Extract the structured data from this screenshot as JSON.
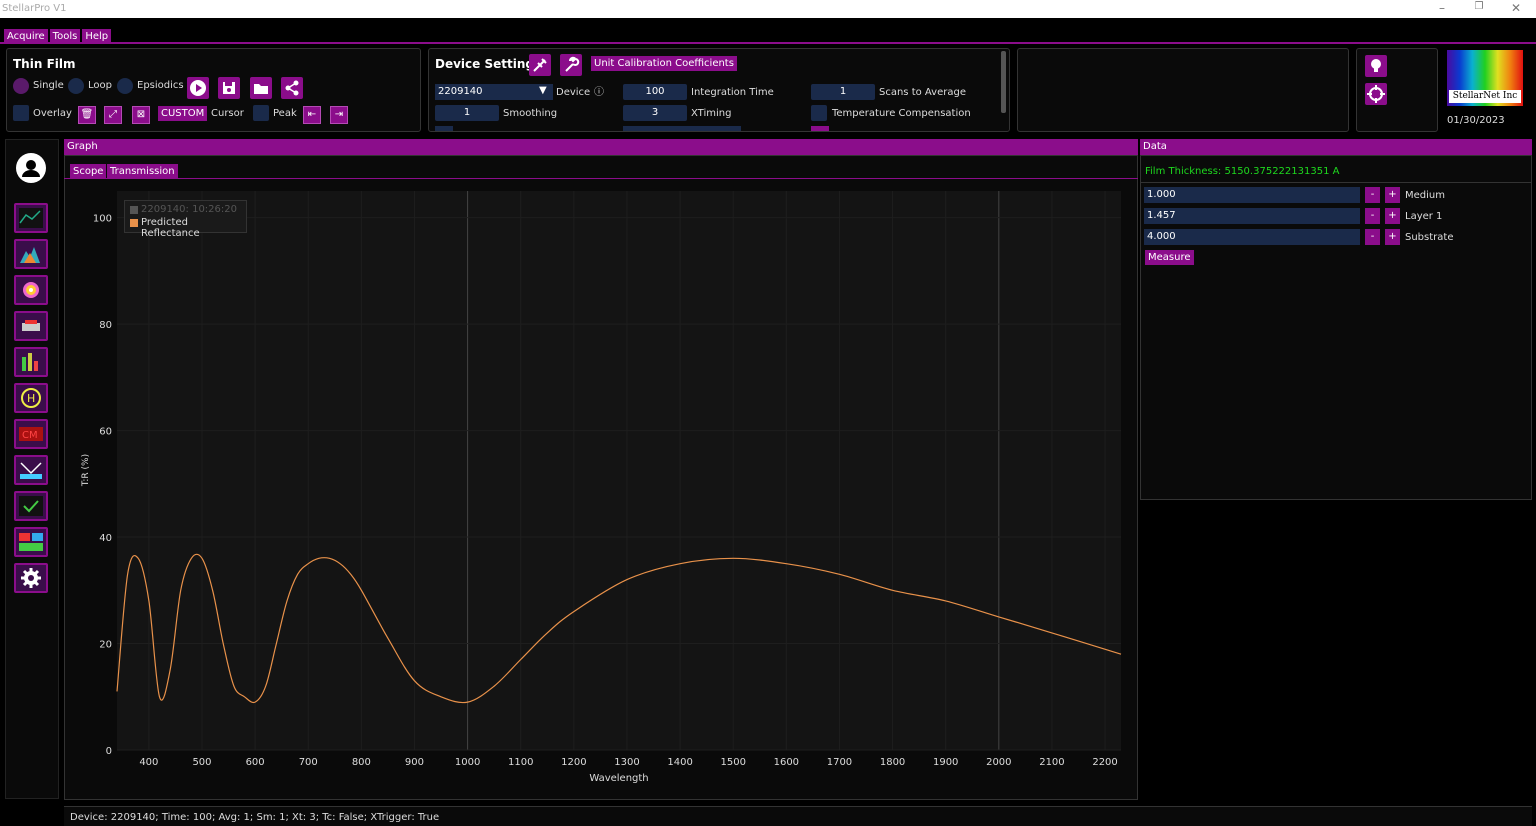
{
  "app": {
    "title": "StellarPro V1"
  },
  "menu": {
    "acquire": "Acquire",
    "tools": "Tools",
    "help": "Help"
  },
  "thin_film": {
    "title": "Thin Film",
    "single": "Single",
    "loop": "Loop",
    "episodics": "Epsiodics",
    "overlay": "Overlay",
    "custom": "CUSTOM",
    "cursor": "Cursor",
    "peak": "Peak"
  },
  "device_settings": {
    "title": "Device Settings",
    "unit_cal": "Unit Calibration Coefficients",
    "device_value": "2209140",
    "device_label": "Device",
    "smoothing_value": "1",
    "smoothing_label": "Smoothing",
    "integration_value": "100",
    "integration_label": "Integration Time",
    "xtiming_value": "3",
    "xtiming_label": "XTiming",
    "scans_value": "1",
    "scans_label": "Scans to Average",
    "temp_label": "Temperature Compensation"
  },
  "logo": {
    "text": "StellarNet Inc",
    "date": "01/30/2023"
  },
  "graph": {
    "header": "Graph",
    "tab_scope": "Scope",
    "tab_transmission": "Transmission",
    "legend_1": "2209140:  10:26:20",
    "legend_2": "Predicted Reflectance"
  },
  "data_panel": {
    "header": "Data",
    "film_thickness": "Film Thickness: 5150.375222131351  A",
    "medium_value": "1.000",
    "medium_label": "Medium",
    "layer1_value": "1.457",
    "layer1_label": "Layer 1",
    "substrate_value": "4.000",
    "substrate_label": "Substrate",
    "measure": "Measure",
    "minus": "-",
    "plus": "+"
  },
  "status_bar": {
    "text": "Device: 2209140; Time: 100; Avg: 1; Sm: 1; Xt: 3; Tc: False; XTrigger: True"
  },
  "colors": {
    "accent": "#8b0d8b",
    "curve": "#e8914a",
    "field": "#1a2a4a"
  },
  "chart_data": {
    "type": "line",
    "xlabel": "Wavelength",
    "ylabel": "T:R (%)",
    "xlim": [
      340,
      2230
    ],
    "ylim": [
      0,
      105
    ],
    "xticks": [
      400,
      500,
      600,
      700,
      800,
      900,
      1000,
      1100,
      1200,
      1300,
      1400,
      1500,
      1600,
      1700,
      1800,
      1900,
      2000,
      2100,
      2200
    ],
    "yticks": [
      0,
      20,
      40,
      60,
      80,
      100
    ],
    "grid": true,
    "legend": "top-left",
    "series": [
      {
        "name": "Predicted Reflectance",
        "x": [
          340,
          360,
          380,
          400,
          420,
          440,
          460,
          480,
          500,
          520,
          540,
          560,
          580,
          600,
          620,
          640,
          660,
          680,
          700,
          720,
          740,
          760,
          780,
          800,
          850,
          900,
          950,
          1000,
          1050,
          1100,
          1150,
          1200,
          1300,
          1400,
          1500,
          1600,
          1700,
          1800,
          1900,
          2000,
          2100,
          2230
        ],
        "y": [
          11,
          33,
          36,
          28,
          10,
          15,
          30,
          36,
          36,
          30,
          20,
          12,
          10,
          9,
          12,
          20,
          28,
          33,
          35,
          36,
          36,
          35,
          33,
          30,
          21,
          13,
          10,
          9,
          12,
          17,
          22,
          26,
          32,
          35,
          36,
          35,
          33,
          30,
          28,
          25,
          22,
          18
        ]
      }
    ]
  }
}
